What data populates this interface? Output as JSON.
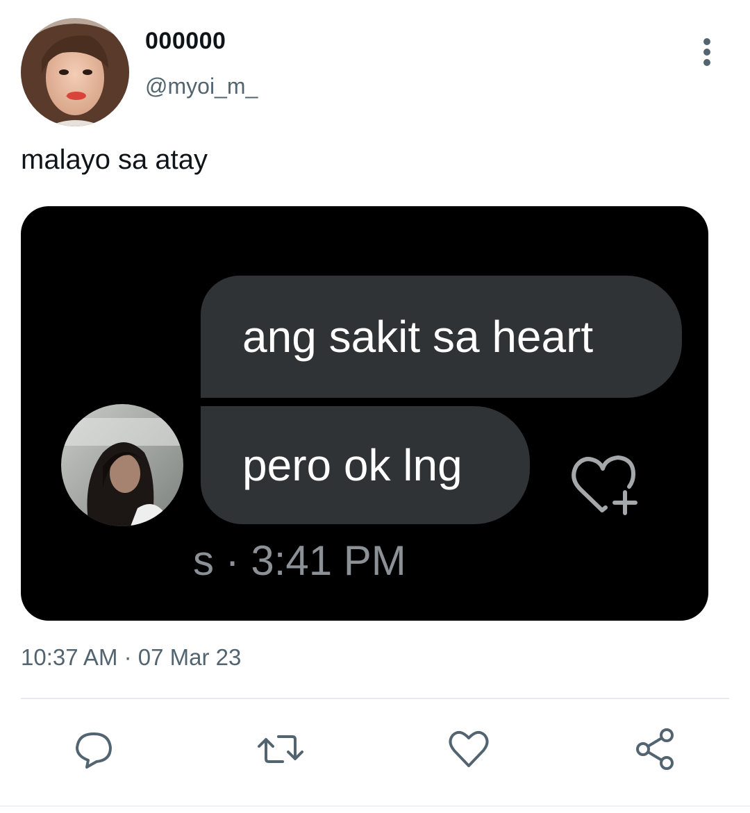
{
  "tweet": {
    "display_name": "000000",
    "handle": "@myoi_m_",
    "text": "malayo sa atay",
    "timestamp": "10:37 AM · 07 Mar 23"
  },
  "media": {
    "messages": [
      {
        "text": "ang sakit sa heart"
      },
      {
        "text": "pero ok lng"
      }
    ],
    "meta": "s · 3:41 PM",
    "icons": [
      "heart-plus-icon"
    ]
  },
  "actions": [
    {
      "name": "reply",
      "icon": "comment-icon"
    },
    {
      "name": "retweet",
      "icon": "retweet-icon"
    },
    {
      "name": "like",
      "icon": "heart-icon"
    },
    {
      "name": "share",
      "icon": "share-icon"
    }
  ],
  "colors": {
    "text": "#0f1419",
    "secondary": "#536471",
    "bubble": "#2f3336",
    "media_bg": "#000000"
  }
}
